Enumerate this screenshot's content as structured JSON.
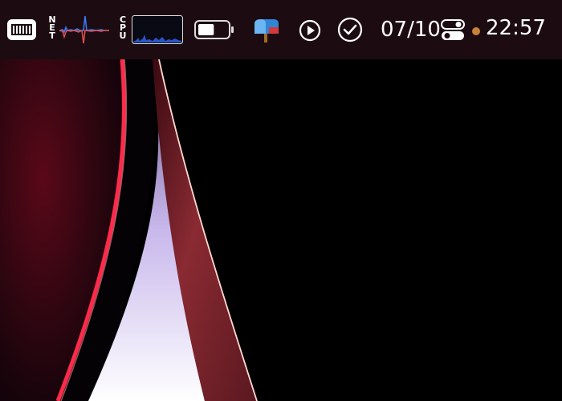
{
  "menubar": {
    "net_label": "NET",
    "cpu_label": "CPU",
    "date": "07/10",
    "time": "22:57",
    "status_dot_color": "#c8823a",
    "battery_level": 0.55
  },
  "icons": {
    "memory": "memory-chip-icon",
    "net_graph": "network-activity-graph-icon",
    "cpu_graph": "cpu-usage-graph-icon",
    "battery": "battery-icon",
    "mail": "mailbox-icon",
    "play": "play-circle-icon",
    "check": "checkmark-circle-icon",
    "control": "control-center-toggle-icon"
  }
}
